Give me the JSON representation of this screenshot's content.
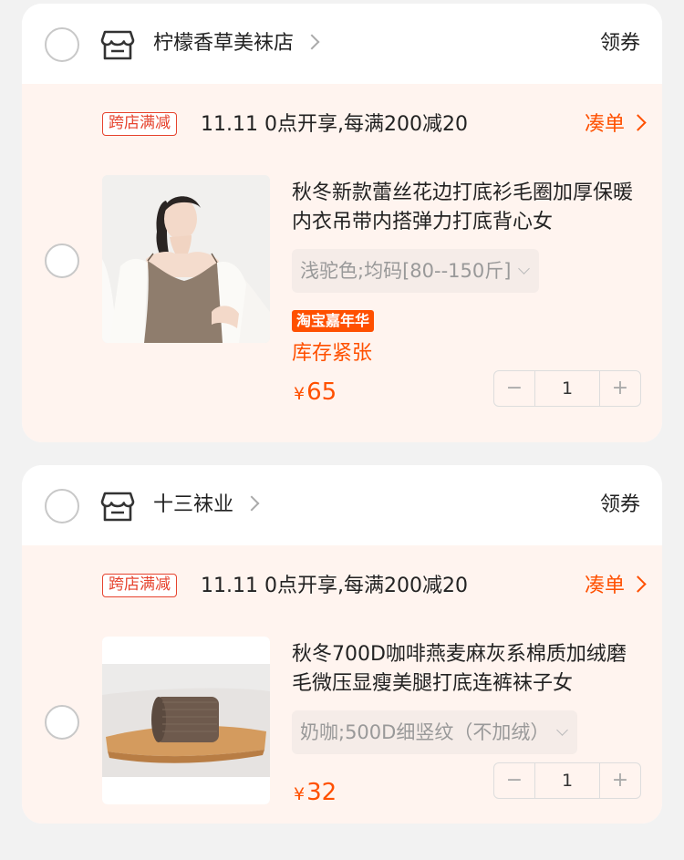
{
  "shops": [
    {
      "name": "柠檬香草美袜店",
      "coupon_label": "领券",
      "promo": {
        "badge": "跨店满减",
        "text": "11.11 0点开享,每满200减20",
        "add_on_label": "凑单"
      },
      "item": {
        "title": "秋冬新款蕾丝花边打底衫毛圈加厚保暖内衣吊带内搭弹力打底背心女",
        "sku": "浅驼色;均码[80--150斤]",
        "festival_badge": "淘宝嘉年华",
        "stock_label": "库存紧张",
        "currency": "¥",
        "price": "65",
        "quantity": "1"
      }
    },
    {
      "name": "十三袜业",
      "coupon_label": "领券",
      "promo": {
        "badge": "跨店满减",
        "text": "11.11 0点开享,每满200减20",
        "add_on_label": "凑单"
      },
      "item": {
        "title": "秋冬700D咖啡燕麦麻灰系棉质加绒磨毛微压显瘦美腿打底连裤袜子女",
        "sku": "奶咖;500D细竖纹（不加绒）",
        "currency": "¥",
        "price": "32",
        "quantity": "1"
      }
    }
  ],
  "qty_controls": {
    "minus": "−",
    "plus": "+"
  },
  "icons": {
    "store": "store-icon",
    "chevron": "chevron-right-icon",
    "dropdown": "chevron-down-icon"
  },
  "colors": {
    "accent": "#ff5000",
    "badge_red": "#e6432e",
    "item_bg": "#fff4ef"
  }
}
